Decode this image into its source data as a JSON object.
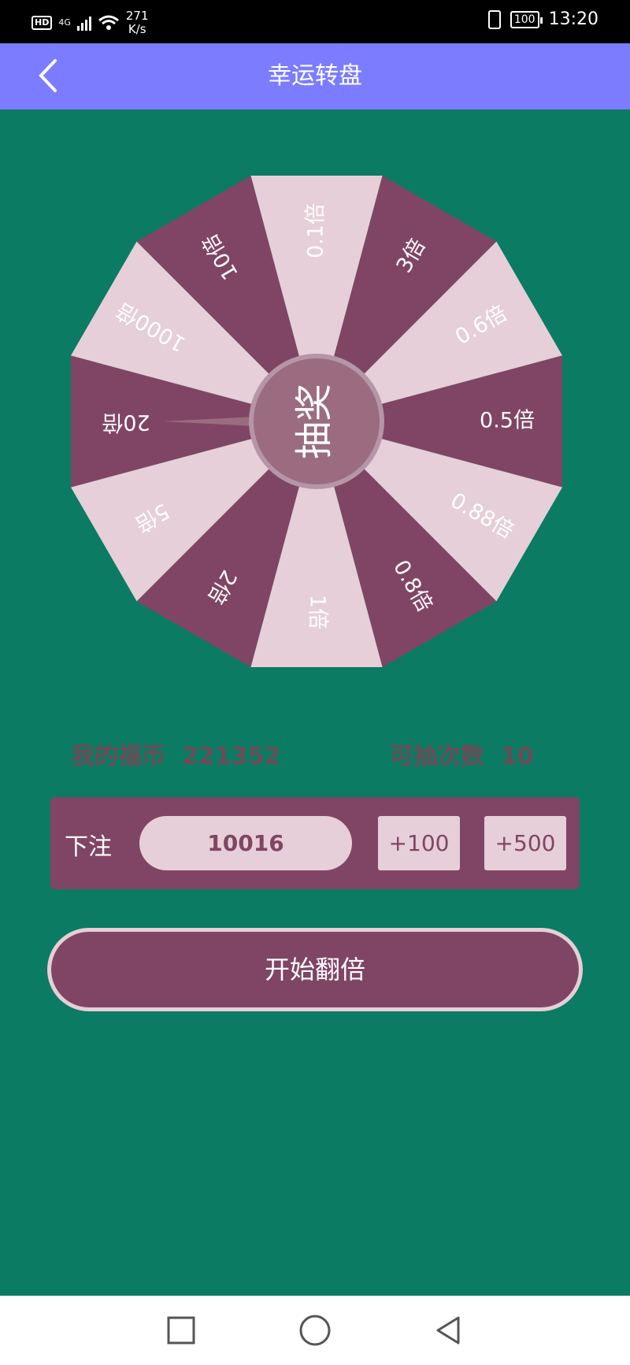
{
  "status_bar": {
    "hd": "HD",
    "network": "4G",
    "speed_value": "271",
    "speed_unit": "K/s",
    "battery": "100",
    "time": "13:20"
  },
  "header": {
    "title": "幸运转盘",
    "back_icon": "chevron-left-icon"
  },
  "wheel": {
    "center_label": "抽奖",
    "segments": [
      "0.1倍",
      "3倍",
      "0.6倍",
      "0.5倍",
      "0.88倍",
      "0.8倍",
      "1倍",
      "2倍",
      "5倍",
      "20倍",
      "1000倍",
      "10倍"
    ],
    "colors": {
      "dark": "#804564",
      "light": "#e6cfd8",
      "center": "#9b6c7f",
      "center_ring": "#b496a8"
    }
  },
  "info": {
    "coins_label": "我的福币",
    "coins_value": "221352",
    "draws_label": "可抽次数",
    "draws_value": "10"
  },
  "bet": {
    "label": "下注",
    "amount": "10016",
    "add100_label": "+100",
    "add500_label": "+500"
  },
  "start_button_label": "开始翻倍",
  "nav": {
    "square_icon": "square-icon",
    "home_icon": "circle-icon",
    "back_icon": "triangle-back-icon"
  },
  "colors": {
    "background": "#0b7b64",
    "header": "#7b7cff",
    "accent": "#804564"
  }
}
